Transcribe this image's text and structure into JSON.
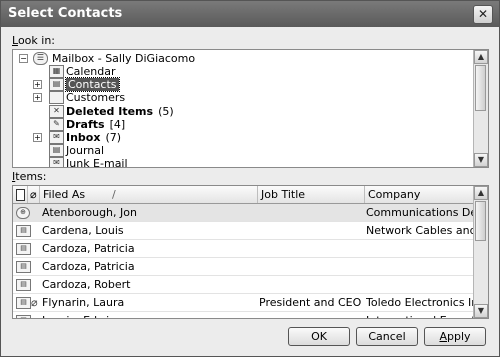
{
  "window": {
    "title": "Select Contacts",
    "close_glyph": "✕"
  },
  "look_in": {
    "label": "Look in:",
    "label_underline_char": "L",
    "label_rest": "ook in:"
  },
  "tree": {
    "root": {
      "label": "Mailbox - Sally DiGiacomo",
      "icon": "mailbox-icon",
      "expander": "−"
    },
    "items": [
      {
        "label": "Calendar",
        "count": "",
        "bold": false,
        "selected": false,
        "expander": "",
        "icon": "calendar-icon",
        "glyph": "▦"
      },
      {
        "label": "Contacts",
        "count": "",
        "bold": false,
        "selected": true,
        "expander": "+",
        "icon": "contacts-icon",
        "glyph": "▤"
      },
      {
        "label": "Customers",
        "count": "",
        "bold": false,
        "selected": false,
        "expander": "+",
        "icon": "folder-icon",
        "glyph": ""
      },
      {
        "label": "Deleted Items",
        "count": "(5)",
        "bold": true,
        "selected": false,
        "expander": "",
        "icon": "deleted-items-icon",
        "glyph": "✕"
      },
      {
        "label": "Drafts",
        "count": "[4]",
        "bold": true,
        "selected": false,
        "expander": "",
        "icon": "drafts-icon",
        "glyph": "✎"
      },
      {
        "label": "Inbox",
        "count": "(7)",
        "bold": true,
        "selected": false,
        "expander": "+",
        "icon": "inbox-icon",
        "glyph": "✉"
      },
      {
        "label": "Journal",
        "count": "",
        "bold": false,
        "selected": false,
        "expander": "",
        "icon": "journal-icon",
        "glyph": "▤"
      },
      {
        "label": "Junk E-mail",
        "count": "",
        "bold": false,
        "selected": false,
        "expander": "",
        "icon": "junk-icon",
        "glyph": "✉"
      }
    ]
  },
  "items_section": {
    "label": "Items:",
    "label_underline_char": "I",
    "label_rest": "tems:"
  },
  "grid": {
    "header": {
      "type_icon": "document-icon",
      "attach_icon": "paperclip-icon",
      "filed_as": "Filed As",
      "sort_arrow": "/",
      "job_title": "Job Title",
      "company": "Company"
    },
    "rows": [
      {
        "icon": "distribution-list-icon",
        "icon_glyph": "⊕",
        "attach": false,
        "filed_as": "Atenborough, Jon",
        "job_title": "",
        "company": "Communications Design...",
        "highlight": true
      },
      {
        "icon": "contact-card-icon",
        "icon_glyph": "▤",
        "attach": false,
        "filed_as": "Cardena, Louis",
        "job_title": "",
        "company": "Network Cables and More",
        "highlight": false
      },
      {
        "icon": "contact-card-icon",
        "icon_glyph": "▤",
        "attach": false,
        "filed_as": "Cardoza, Patricia",
        "job_title": "",
        "company": "",
        "highlight": false
      },
      {
        "icon": "contact-card-icon",
        "icon_glyph": "▤",
        "attach": false,
        "filed_as": "Cardoza, Patricia",
        "job_title": "",
        "company": "",
        "highlight": false
      },
      {
        "icon": "contact-card-icon",
        "icon_glyph": "▤",
        "attach": false,
        "filed_as": "Cardoza, Robert",
        "job_title": "",
        "company": "",
        "highlight": false
      },
      {
        "icon": "contact-card-icon",
        "icon_glyph": "▤",
        "attach": true,
        "filed_as": "Flynarin, Laura",
        "job_title": "President and CEO",
        "company": "Toledo Electronics Inco...",
        "highlight": false
      },
      {
        "icon": "contact-card-icon",
        "icon_glyph": "▤",
        "attach": true,
        "filed_as": "Laurio, Edwin",
        "job_title": "",
        "company": "International Exports",
        "highlight": false
      }
    ]
  },
  "buttons": {
    "ok": "OK",
    "cancel": "Cancel",
    "apply": "Apply",
    "apply_underline_char": "A",
    "apply_rest": "pply"
  },
  "scroll": {
    "up_glyph": "▲",
    "down_glyph": "▼"
  }
}
